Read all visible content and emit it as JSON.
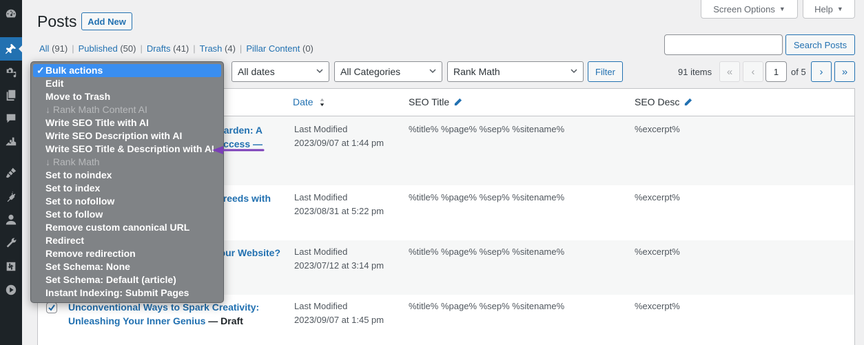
{
  "sidebar": {
    "items": [
      {
        "icon": "dashboard-icon",
        "active": false
      },
      {
        "icon": "posts-pin-icon",
        "active": true
      },
      {
        "icon": "media-icon",
        "active": false
      },
      {
        "icon": "pages-icon",
        "active": false
      },
      {
        "icon": "comments-icon",
        "active": false
      },
      {
        "icon": "rank-math-icon",
        "active": false
      },
      {
        "icon": "appearance-brush-icon",
        "active": false
      },
      {
        "icon": "plugins-icon",
        "active": false
      },
      {
        "icon": "users-icon",
        "active": false
      },
      {
        "icon": "tools-wrench-icon",
        "active": false
      },
      {
        "icon": "settings-sliders-icon",
        "active": false
      },
      {
        "icon": "play-circle-icon",
        "active": false
      }
    ]
  },
  "header": {
    "title": "Posts",
    "add_new_label": "Add New",
    "screen_options_label": "Screen Options",
    "help_label": "Help",
    "tab_caret": "▼"
  },
  "views": [
    {
      "label": "All",
      "count": "(91)"
    },
    {
      "label": "Published",
      "count": "(50)"
    },
    {
      "label": "Drafts",
      "count": "(41)"
    },
    {
      "label": "Trash",
      "count": "(4)"
    },
    {
      "label": "Pillar Content",
      "count": "(0)"
    }
  ],
  "views_separator": "|",
  "search": {
    "value": "",
    "placeholder": "",
    "button_label": "Search Posts"
  },
  "filters": {
    "dates_selected": "All dates",
    "categories_selected": "All Categories",
    "rank_math_selected": "Rank Math",
    "filter_button_label": "Filter"
  },
  "pagination": {
    "items_count": "91 items",
    "first": "«",
    "prev": "‹",
    "current_page": "1",
    "of_label": "of 5",
    "next": "›",
    "last": "»"
  },
  "bulk_actions": {
    "check": "✓",
    "items": [
      {
        "label": "Bulk actions",
        "type": "selected"
      },
      {
        "label": "Edit",
        "type": "option"
      },
      {
        "label": "Move to Trash",
        "type": "option"
      },
      {
        "label": "↓ Rank Math Content AI",
        "type": "group"
      },
      {
        "label": "Write SEO Title with AI",
        "type": "option"
      },
      {
        "label": "Write SEO Description with AI",
        "type": "option"
      },
      {
        "label": "Write SEO Title & Description with AI",
        "type": "option"
      },
      {
        "label": "↓ Rank Math",
        "type": "group"
      },
      {
        "label": "Set to noindex",
        "type": "option"
      },
      {
        "label": "Set to index",
        "type": "option"
      },
      {
        "label": "Set to nofollow",
        "type": "option"
      },
      {
        "label": "Set to follow",
        "type": "option"
      },
      {
        "label": "Remove custom canonical URL",
        "type": "option"
      },
      {
        "label": "Redirect",
        "type": "option"
      },
      {
        "label": "Remove redirection",
        "type": "option"
      },
      {
        "label": "Set Schema: None",
        "type": "option"
      },
      {
        "label": "Set Schema: Default (article)",
        "type": "option"
      },
      {
        "label": "Instant Indexing: Submit Pages",
        "type": "option"
      }
    ]
  },
  "annotation": {
    "arrow_color": "#7b3fb8",
    "points_to": "Write SEO Title & Description with AI"
  },
  "table": {
    "columns": {
      "date": "Date",
      "seo_title": "SEO Title",
      "seo_desc": "SEO Desc"
    },
    "rows": [
      {
        "title_visible_line1": "arden: A",
        "title_visible_line2": "ccess —",
        "state": "",
        "date_label": "Last Modified",
        "date_value": "2023/09/07 at 1:44 pm",
        "seo_title": "%title% %page% %sep% %sitename%",
        "seo_desc": "%excerpt%",
        "checked": false
      },
      {
        "title_visible_line1": "reeds with",
        "title_visible_line2": "",
        "state": "",
        "date_label": "Last Modified",
        "date_value": "2023/08/31 at 5:22 pm",
        "seo_title": "%title% %page% %sep% %sitename%",
        "seo_desc": "%excerpt%",
        "checked": false
      },
      {
        "title_visible_line1": "our Website?",
        "title_visible_line2": "",
        "state": "",
        "date_label": "Last Modified",
        "date_value": "2023/07/12 at 3:14 pm",
        "seo_title": "%title% %page% %sep% %sitename%",
        "seo_desc": "%excerpt%",
        "checked": false
      },
      {
        "title_visible_line1": "Unconventional Ways to Spark Creativity:",
        "title_visible_line2": "Unleashing Your Inner Genius",
        "state": " — Draft",
        "date_label": "Last Modified",
        "date_value": "2023/09/07 at 1:45 pm",
        "seo_title": "%title% %page% %sep% %sitename%",
        "seo_desc": "%excerpt%",
        "checked": true
      }
    ]
  },
  "colors": {
    "accent": "#2271b1",
    "sidebar_bg": "#1d2327",
    "menu_bg": "#808386",
    "menu_selected": "#3a8ef0"
  }
}
